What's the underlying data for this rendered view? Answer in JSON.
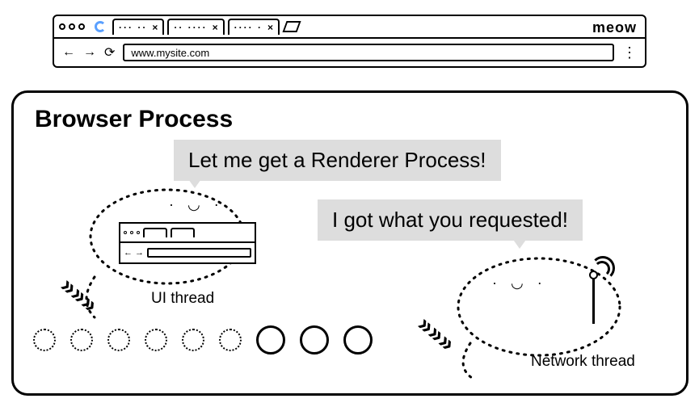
{
  "browser": {
    "brand": "meow",
    "url": "www.mysite.com",
    "tabs": [
      {
        "label": "··· ··",
        "close": "×"
      },
      {
        "label": "·· ····",
        "close": "×"
      },
      {
        "label": "···· ·",
        "close": "×"
      }
    ],
    "nav": {
      "back": "←",
      "forward": "→",
      "reload": "⟳",
      "overflow": "⋮"
    }
  },
  "process": {
    "title": "Browser Process",
    "ui_thread": {
      "label": "UI thread",
      "speech": "Let me get a Renderer Process!"
    },
    "network_thread": {
      "label": "Network thread",
      "speech": "I got what you requested!"
    }
  }
}
